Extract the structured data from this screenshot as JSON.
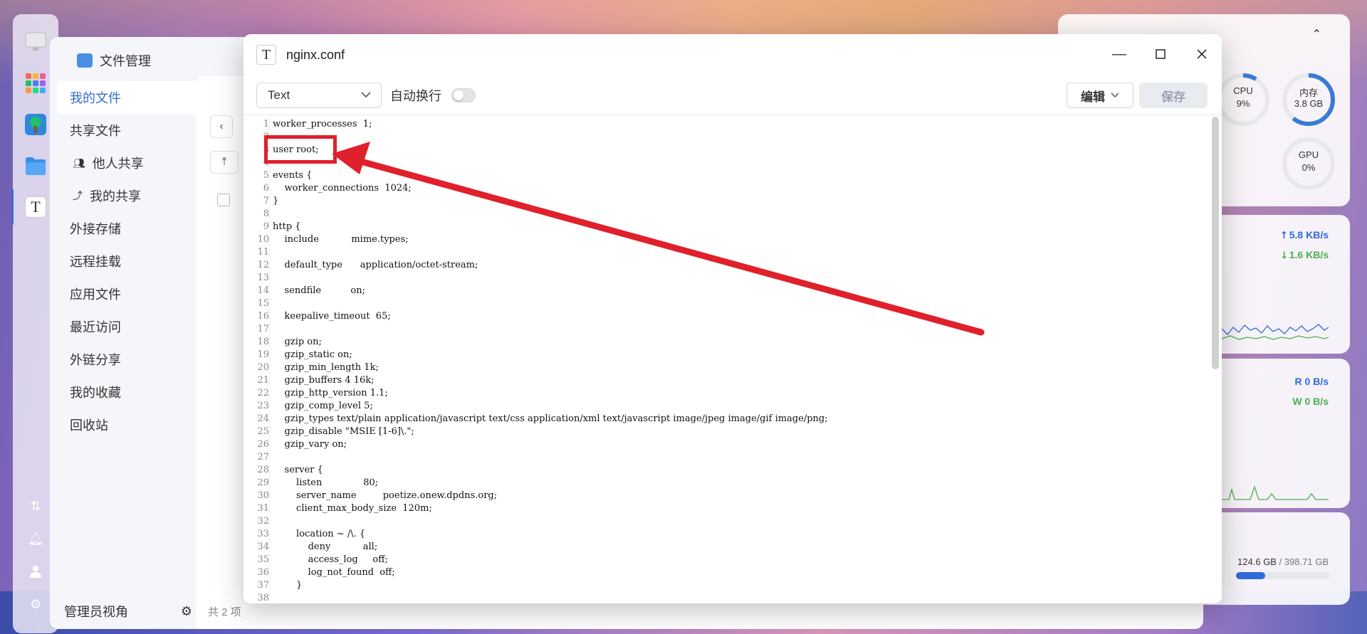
{
  "file_manager": {
    "title": "文件管理",
    "sidebar": [
      {
        "label": "我的文件",
        "active": true,
        "icon": "folder-icon"
      },
      {
        "label": "共享文件",
        "active": false,
        "icon": "chevron-icon"
      },
      {
        "label": "他人共享",
        "active": false,
        "icon": "users-icon",
        "sub": true
      },
      {
        "label": "我的共享",
        "active": false,
        "icon": "share-icon",
        "sub": true
      },
      {
        "label": "外接存储",
        "active": false,
        "icon": "drive-icon"
      },
      {
        "label": "远程挂载",
        "active": false,
        "icon": "cloud-icon"
      },
      {
        "label": "应用文件",
        "active": false,
        "icon": "app-icon"
      },
      {
        "label": "最近访问",
        "active": false,
        "icon": "clock-icon"
      },
      {
        "label": "外链分享",
        "active": false,
        "icon": "link-icon"
      },
      {
        "label": "我的收藏",
        "active": false,
        "icon": "star-icon"
      },
      {
        "label": "回收站",
        "active": false,
        "icon": "trash-icon"
      }
    ],
    "footer_label": "管理员视角",
    "item_count": "共 2 项"
  },
  "widgets": {
    "cpu_label": "CPU",
    "cpu_value": "9%",
    "mem_label": "内存",
    "mem_value": "3.8 GB",
    "gpu_label": "GPU",
    "gpu_value": "0%",
    "net_up": "5.8 KB/s",
    "net_down": "1.6 KB/s",
    "disk_read": "R 0 B/s",
    "disk_write": "W 0 B/s",
    "storage_used": "124.6 GB",
    "storage_total": "/ 398.71 GB",
    "storage_fraction": 0.31
  },
  "editor": {
    "filename": "nginx.conf",
    "mode": "Text",
    "wrap_label": "自动换行",
    "wrap_enabled": false,
    "edit_button": "编辑",
    "save_button": "保存",
    "lines": [
      "worker_processes  1;",
      "",
      "user root;",
      "",
      "events {",
      "    worker_connections  1024;",
      "}",
      "",
      "http {",
      "    include           mime.types;",
      "",
      "    default_type      application/octet-stream;",
      "",
      "    sendfile          on;",
      "",
      "    keepalive_timeout  65;",
      "",
      "    gzip on;",
      "    gzip_static on;",
      "    gzip_min_length 1k;",
      "    gzip_buffers 4 16k;",
      "    gzip_http_version 1.1;",
      "    gzip_comp_level 5;",
      "    gzip_types text/plain application/javascript text/css application/xml text/javascript image/jpeg image/gif image/png;",
      "    gzip_disable \"MSIE [1-6]\\.\";",
      "    gzip_vary on;",
      "",
      "    server {",
      "        listen              80;",
      "        server_name         poetize.onew.dpdns.org;",
      "        client_max_body_size  120m;",
      "",
      "        location ~ /\\. {",
      "            deny           all;",
      "            access_log     off;",
      "            log_not_found  off;",
      "        }",
      ""
    ]
  },
  "colors": {
    "accent": "#2f6bd8",
    "annotation": "#e0202a",
    "net_up": "#2f6bd8",
    "net_down": "#4caf50"
  }
}
